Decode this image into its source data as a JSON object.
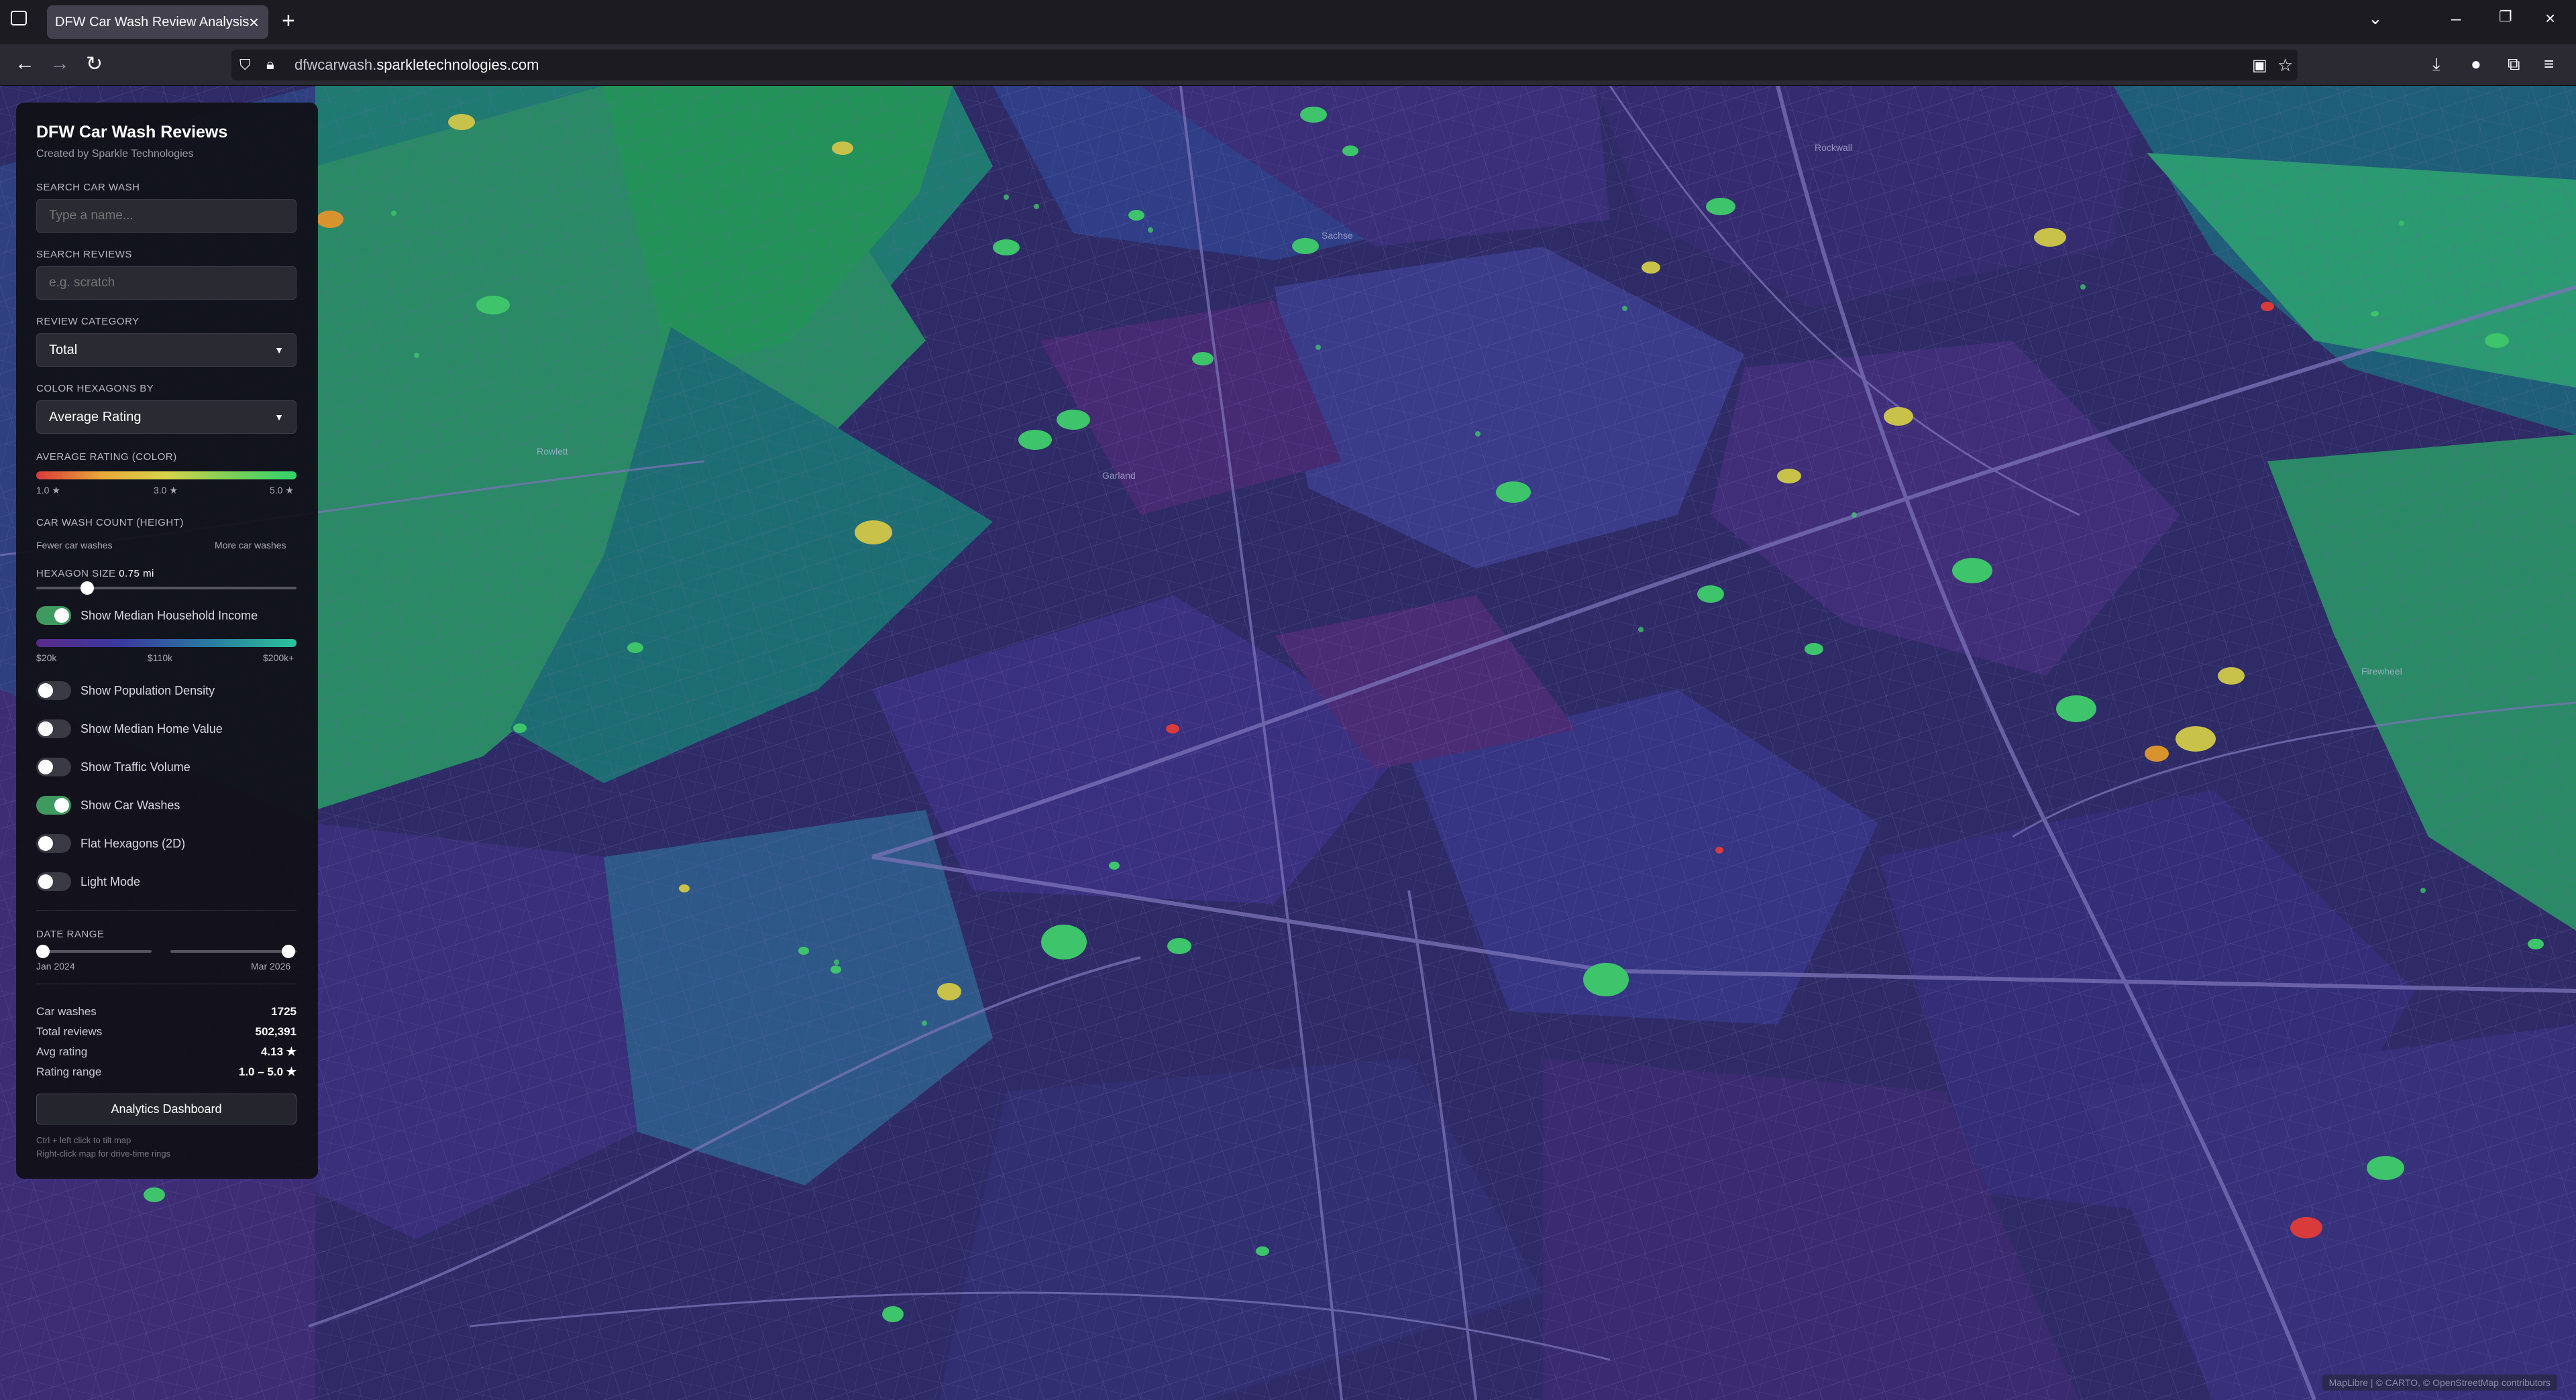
{
  "browser": {
    "tab_title": "DFW Car Wash Review Analysis",
    "url_prefix": "dfwcarwash.",
    "url_domain": "sparkletechnologies.com"
  },
  "panel": {
    "title": "DFW Car Wash Reviews",
    "subtitle": "Created by Sparkle Technologies",
    "search_car_wash_label": "SEARCH CAR WASH",
    "search_car_wash_placeholder": "Type a name...",
    "search_reviews_label": "SEARCH REVIEWS",
    "search_reviews_placeholder": "e.g. scratch",
    "review_category_label": "REVIEW CATEGORY",
    "review_category_value": "Total",
    "color_by_label": "COLOR HEXAGONS BY",
    "color_by_value": "Average Rating",
    "avg_rating_label": "AVERAGE RATING (COLOR)",
    "avg_rating_ticks": [
      "1.0 ★",
      "3.0 ★",
      "5.0 ★"
    ],
    "count_label": "CAR WASH COUNT (HEIGHT)",
    "count_low": "Fewer car washes",
    "count_high": "More car washes",
    "hex_size_label": "HEXAGON SIZE",
    "hex_size_value": "0.75 mi",
    "income_ticks": [
      "$20k",
      "$110k",
      "$200k+"
    ],
    "toggles": [
      {
        "label": "Show Median Household Income",
        "on": true
      },
      {
        "label": "Show Population Density",
        "on": false
      },
      {
        "label": "Show Median Home Value",
        "on": false
      },
      {
        "label": "Show Traffic Volume",
        "on": false
      },
      {
        "label": "Show Car Washes",
        "on": true
      },
      {
        "label": "Flat Hexagons (2D)",
        "on": false
      },
      {
        "label": "Light Mode",
        "on": false
      }
    ],
    "date_range_label": "DATE RANGE",
    "date_start": "Jan 2024",
    "date_end": "Mar 2026",
    "stats": [
      {
        "label": "Car washes",
        "value": "1725"
      },
      {
        "label": "Total reviews",
        "value": "502,391"
      },
      {
        "label": "Avg rating",
        "value": "4.13 ★"
      },
      {
        "label": "Rating range",
        "value": "1.0 – 5.0 ★"
      }
    ],
    "dashboard_button": "Analytics Dashboard",
    "hint1": "Ctrl + left click to tilt map",
    "hint2": "Right-click map for drive-time rings"
  },
  "map": {
    "attribution": "MapLibre | © CARTO, © OpenStreetMap contributors",
    "place_labels": [
      "Rowlett",
      "Garland",
      "Rockwall",
      "Sachse",
      "Firewheel"
    ]
  },
  "colors": {
    "accent_green": "#3f9a5f",
    "marker_green": "#3ec46a",
    "marker_yellow": "#c9c24a",
    "marker_orange": "#d9932e",
    "marker_red": "#d93a3a"
  },
  "icons": [
    "tab-list-icon",
    "close-icon",
    "plus-icon",
    "chevron-down-icon",
    "minimize-icon",
    "restore-icon",
    "back-icon",
    "forward-icon",
    "reload-icon",
    "shield-icon",
    "lock-icon",
    "download-icon",
    "account-icon",
    "extensions-icon",
    "menu-icon"
  ]
}
